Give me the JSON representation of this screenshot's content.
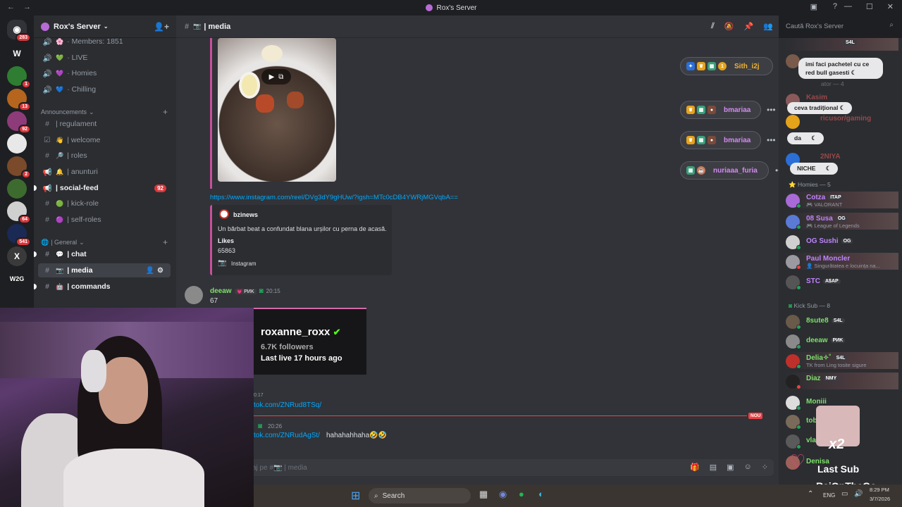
{
  "window": {
    "title": "Rox's Server"
  },
  "rail": {
    "home_badge": "283",
    "servers": [
      {
        "icon": "W",
        "badge": ""
      },
      {
        "icon": "",
        "badge": "1"
      },
      {
        "icon": "",
        "badge": "13"
      },
      {
        "icon": "",
        "badge": "92"
      },
      {
        "icon": "",
        "badge": ""
      },
      {
        "icon": "",
        "badge": "2"
      },
      {
        "icon": "",
        "badge": ""
      },
      {
        "icon": "",
        "badge": "64"
      },
      {
        "icon": "",
        "badge": "541"
      },
      {
        "icon": "X",
        "badge": ""
      },
      {
        "icon": "W2G",
        "badge": ""
      }
    ]
  },
  "server": {
    "name": "Rox's Server"
  },
  "channels": {
    "top": [
      {
        "emoji": "🌸",
        "label": "· Members: 1851"
      },
      {
        "emoji": "💚",
        "label": "· LIVE"
      },
      {
        "emoji": "💜",
        "label": "· Homies"
      },
      {
        "emoji": "💙",
        "label": "· Chilling"
      }
    ],
    "announcements_label": "Announcements",
    "announcements": [
      {
        "emoji": "",
        "label": "| regulament",
        "bold": false,
        "badge": ""
      },
      {
        "emoji": "👋",
        "label": "| welcome",
        "bold": false,
        "badge": ""
      },
      {
        "emoji": "🔎",
        "label": "| roles",
        "bold": false,
        "badge": ""
      },
      {
        "emoji": "🔔",
        "label": "| anunturi",
        "bold": false,
        "badge": ""
      },
      {
        "emoji": "",
        "label": "| social-feed",
        "bold": true,
        "badge": "92"
      },
      {
        "emoji": "🟢",
        "label": "| kick-role",
        "bold": false,
        "badge": ""
      },
      {
        "emoji": "🟣",
        "label": "| self-roles",
        "bold": false,
        "badge": ""
      }
    ],
    "general_label": "| General",
    "general": [
      {
        "emoji": "💬",
        "label": "| chat",
        "bold": true
      },
      {
        "emoji": "",
        "label": "| media",
        "bold": true
      },
      {
        "emoji": "",
        "label": "| commands",
        "bold": true
      }
    ]
  },
  "chat_header": {
    "channel": "| media"
  },
  "search": {
    "placeholder": "Caută Rox's Server"
  },
  "messages": {
    "link1": "https://www.instagram.com/reel/DVg3dY9gHUw/?igsh=MTc0cDB4YWRjMGVqbA==",
    "embed": {
      "author": "bzinews",
      "text": "Un bărbat beat a confundat blana urșilor cu perna de acasă.",
      "likes_label": "Likes",
      "likes": "65863",
      "footer": "Instagram"
    },
    "msg2": {
      "author": "deeaw",
      "tag": "PИK",
      "time": "20:15",
      "text": "67"
    },
    "msg3": {
      "time_partial": "0:17",
      "link": "tok.com/ZNRud8TSq/"
    },
    "new_label": "NOU",
    "msg4": {
      "time": "20:26",
      "link": "tok.com/ZNRudAgSt/",
      "text": "hahahahhaha🤣🤣"
    }
  },
  "composer": {
    "placeholder": "aj pe #📷 | media"
  },
  "overlay_pills": [
    {
      "name": "Sith_i2j",
      "color": "#f0b232"
    },
    {
      "name": "bmariaa",
      "color": "#d38bf0"
    },
    {
      "name": "bmariaa",
      "color": "#d38bf0"
    },
    {
      "name": "nuriaaa_furia",
      "color": "#d38bf0"
    }
  ],
  "overlay_bubbles": [
    {
      "text": "imi faci pachetel cu ce red bull gasesti"
    },
    {
      "text": "ceva tradițional"
    },
    {
      "text": "da"
    },
    {
      "text": "NICHE"
    }
  ],
  "members": {
    "top_tag": "S4L",
    "homies_header": "Homies — 5",
    "homies": [
      {
        "name": "Cotza",
        "tag": "ITAP",
        "sub": "🎮 VALORANT",
        "color": "#c084fc"
      },
      {
        "name": "08 Susa",
        "tag": "OG",
        "sub": "🎮 League of Legends",
        "color": "#c084fc"
      },
      {
        "name": "OG Sushi",
        "tag": "OG",
        "sub": "",
        "color": "#c084fc"
      },
      {
        "name": "Paul Moncler",
        "tag": "",
        "sub": "👤 Singurătatea e locuința na...",
        "color": "#c084fc"
      },
      {
        "name": "STC",
        "tag": "A$AP",
        "sub": "",
        "color": "#c084fc"
      }
    ],
    "kick_header": "Kick Sub — 8",
    "kick": [
      {
        "name": "8sute8",
        "tag": "S4L",
        "sub": "",
        "color": "#7ee06b"
      },
      {
        "name": "deeaw",
        "tag": "PИK",
        "sub": "",
        "color": "#7ee06b"
      },
      {
        "name": "Delia✧˚",
        "tag": "S4L",
        "sub": "TK from Ling tosite sigure",
        "color": "#7ee06b"
      },
      {
        "name": "Diaz",
        "tag": "NMY",
        "sub": "",
        "color": "#7ee06b"
      },
      {
        "name": "Moniii",
        "tag": "",
        "sub": "",
        "color": "#7ee06b"
      },
      {
        "name": "tobix",
        "tag": "",
        "sub": "",
        "color": "#7ee06b"
      },
      {
        "name": "vlade",
        "tag": "",
        "sub": "",
        "color": "#7ee06b"
      },
      {
        "name": "Denisa",
        "tag": "",
        "sub": "",
        "color": "#7ee06b"
      }
    ],
    "upper_faded": [
      {
        "name": "Kasim"
      },
      {
        "name": "ricusor/gaming"
      },
      {
        "name": "2NIYA"
      }
    ],
    "upper_header_partial": "ator — 4"
  },
  "stream": {
    "streamer": "roxanne_roxx",
    "followers": "6.7K followers",
    "last_live": "Last live 17 hours ago",
    "multiplier": "x2",
    "last_sub_label": "Last Sub",
    "last_sub_name": "RaiOnTheGo"
  },
  "taskbar": {
    "search": "Search",
    "lang": "ENG",
    "time": "8:29 PM",
    "date": "3/7/2026"
  }
}
